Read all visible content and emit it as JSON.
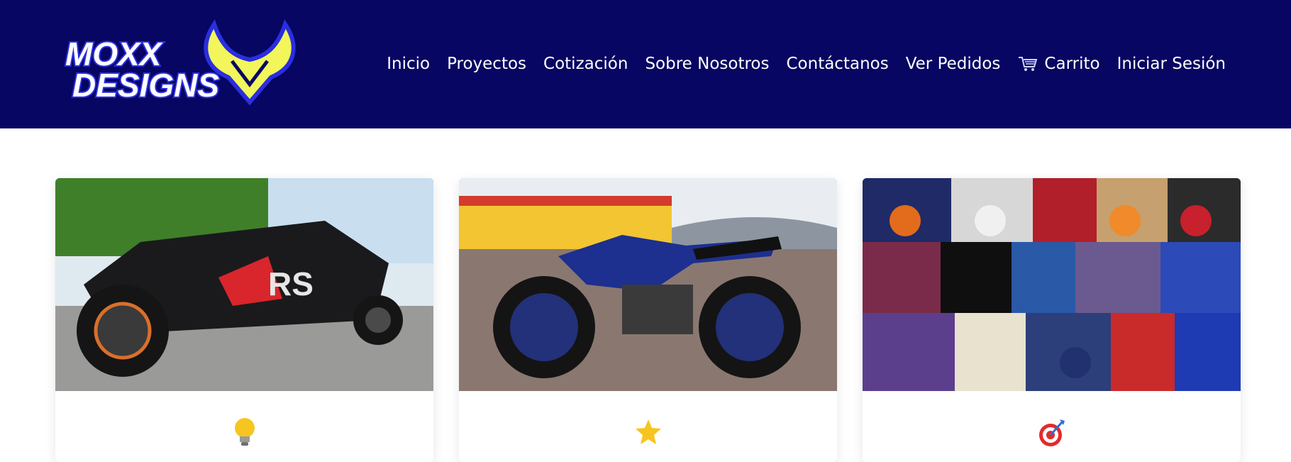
{
  "brand": {
    "logo_text_line1": "MOXX",
    "logo_text_line2": "DESIGNS",
    "colors": {
      "header_bg": "#070662",
      "logo_yellow": "#F2F65A",
      "logo_blue": "#2A2EE0"
    }
  },
  "nav": {
    "items": [
      {
        "label": "Inicio"
      },
      {
        "label": "Proyectos"
      },
      {
        "label": "Cotización"
      },
      {
        "label": "Sobre Nosotros"
      },
      {
        "label": "Contáctanos"
      },
      {
        "label": "Ver Pedidos"
      },
      {
        "label": "Carrito",
        "icon": "cart-icon"
      },
      {
        "label": "Iniciar Sesión"
      }
    ]
  },
  "cards": [
    {
      "image": "utv-xrs-photo",
      "icon": "lightbulb-icon"
    },
    {
      "image": "blue-motorcycle-photo",
      "icon": "star-icon"
    },
    {
      "image": "motorcycle-collage-photo",
      "icon": "target-icon"
    }
  ]
}
